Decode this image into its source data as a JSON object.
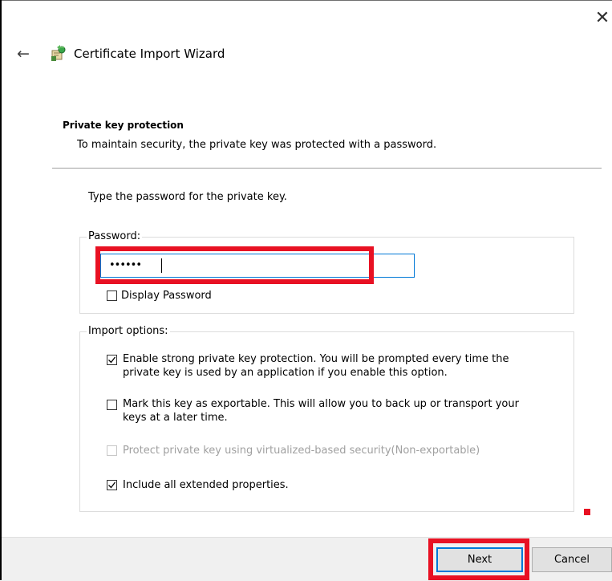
{
  "window": {
    "title": "Certificate Import Wizard"
  },
  "header": {
    "section_title": "Private key protection",
    "section_description": "To maintain security, the private key was protected with a password."
  },
  "main": {
    "instruction": "Type the password for the private key.",
    "password_group": {
      "label": "Password:",
      "password_value_masked": "••••••",
      "display_password_label": "Display Password",
      "display_password_checked": false
    },
    "import_options": {
      "label": "Import options:",
      "options": [
        {
          "line1": "Enable strong private key protection. You will be prompted every time the",
          "line2": "private key is used by an application if you enable this option.",
          "checked": true,
          "enabled": true
        },
        {
          "line1": "Mark this key as exportable. This will allow you to back up or transport your",
          "line2": "keys at a later time.",
          "checked": false,
          "enabled": true
        },
        {
          "line1": "Protect private key using virtualized-based security(Non-exportable)",
          "line2": "",
          "checked": false,
          "enabled": false
        },
        {
          "line1": "Include all extended properties.",
          "line2": "",
          "checked": true,
          "enabled": true
        }
      ]
    }
  },
  "footer": {
    "next_label": "Next",
    "cancel_label": "Cancel"
  },
  "icons": {
    "close": "close-icon",
    "back": "back-arrow-icon",
    "wizard": "certificate-wizard-icon"
  },
  "colors": {
    "accent": "#0078d7",
    "highlight": "#e81123",
    "footer_bg": "#f0f0f0"
  }
}
